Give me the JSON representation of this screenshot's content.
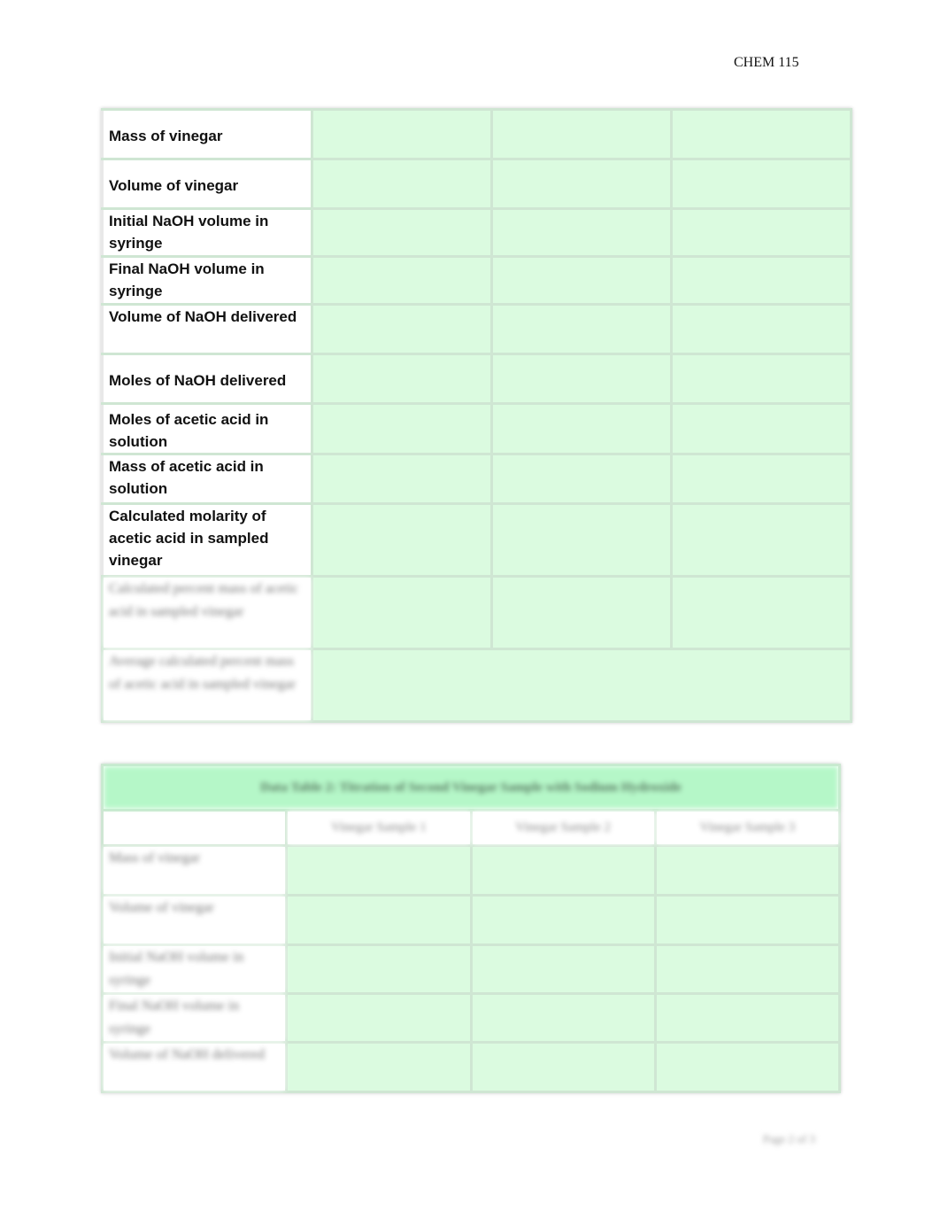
{
  "header": {
    "course": "CHEM 115"
  },
  "table1": {
    "rows": [
      {
        "label": "Mass of vinegar"
      },
      {
        "label": "Volume of vinegar"
      },
      {
        "label": "Initial NaOH volume in syringe"
      },
      {
        "label": "Final NaOH volume in syringe"
      },
      {
        "label": "Volume of NaOH delivered"
      },
      {
        "label": "Moles of NaOH delivered"
      },
      {
        "label": "Moles of acetic acid in solution"
      },
      {
        "label": "Mass of acetic acid in solution"
      },
      {
        "label": "Calculated molarity of acetic acid in sampled vinegar"
      },
      {
        "label": "Calculated percent mass of acetic acid in sampled vinegar"
      },
      {
        "label": "Average calculated percent mass of acetic acid in sampled vinegar"
      }
    ]
  },
  "table2": {
    "title": "Data Table 2: Titration of Second Vinegar Sample with Sodium Hydroxide",
    "columns": [
      "",
      "Vinegar Sample 1",
      "Vinegar Sample 2",
      "Vinegar Sample 3"
    ],
    "rows": [
      {
        "label": "Mass of vinegar"
      },
      {
        "label": "Volume of vinegar"
      },
      {
        "label": "Initial NaOH volume in syringe"
      },
      {
        "label": "Final NaOH volume in syringe"
      },
      {
        "label": "Volume of NaOH delivered"
      }
    ]
  },
  "footer": {
    "page": "Page 2 of 3"
  },
  "colors": {
    "cell_fill": "#dbfbe0",
    "title_fill": "#b5f7c8",
    "border": "#cfe6d3"
  }
}
